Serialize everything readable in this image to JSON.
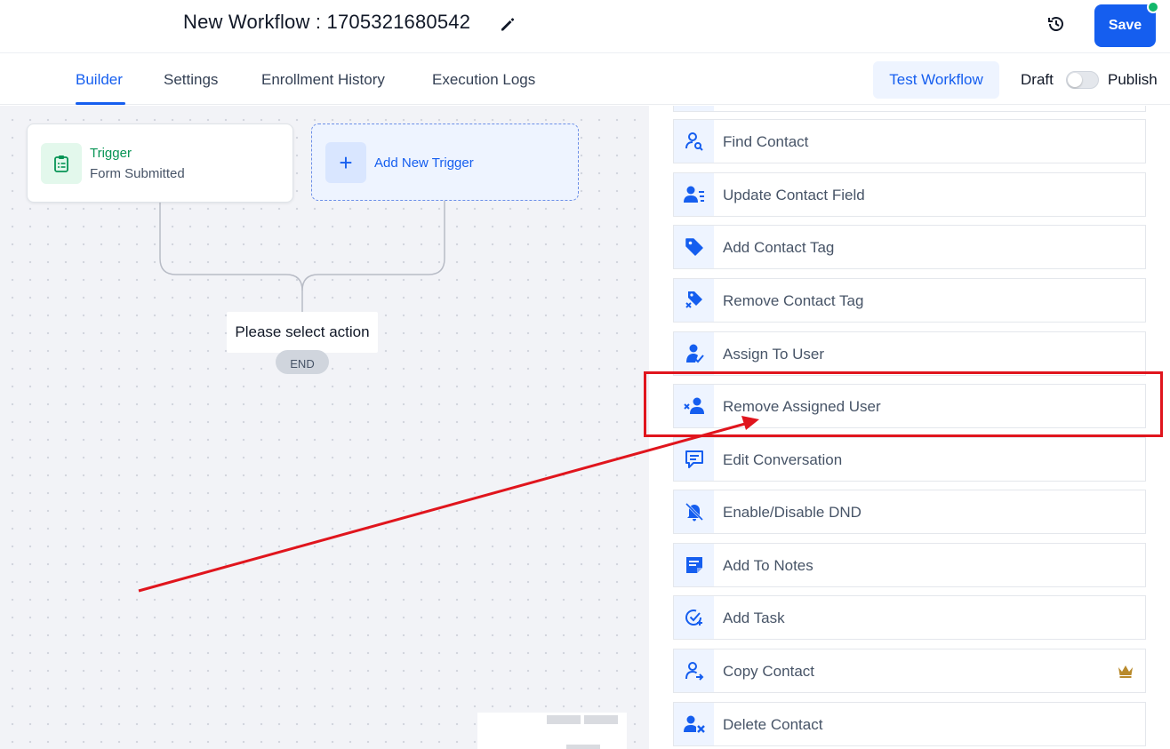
{
  "header": {
    "title": "New Workflow : 1705321680542",
    "save_label": "Save"
  },
  "tabs": [
    {
      "label": "Builder",
      "active": true
    },
    {
      "label": "Settings"
    },
    {
      "label": "Enrollment History"
    },
    {
      "label": "Execution Logs"
    }
  ],
  "toolbar": {
    "test_label": "Test Workflow",
    "draft_label": "Draft",
    "publish_label": "Publish"
  },
  "canvas": {
    "trigger": {
      "title": "Trigger",
      "subtitle": "Form Submitted"
    },
    "add_trigger_label": "Add New Trigger",
    "select_action_label": "Please select action",
    "end_label": "END"
  },
  "actions": [
    {
      "label": "Find Contact",
      "icon": "find-contact-icon"
    },
    {
      "label": "Update Contact Field",
      "icon": "update-contact-field-icon"
    },
    {
      "label": "Add Contact Tag",
      "icon": "tag-icon"
    },
    {
      "label": "Remove Contact Tag",
      "icon": "remove-tag-icon"
    },
    {
      "label": "Assign To User",
      "icon": "assign-user-icon"
    },
    {
      "label": "Remove Assigned User",
      "icon": "remove-user-icon"
    },
    {
      "label": "Edit Conversation",
      "icon": "conversation-icon"
    },
    {
      "label": "Enable/Disable DND",
      "icon": "bell-off-icon"
    },
    {
      "label": "Add To Notes",
      "icon": "notes-icon"
    },
    {
      "label": "Add Task",
      "icon": "task-icon"
    },
    {
      "label": "Copy Contact",
      "icon": "copy-contact-icon",
      "premium": true
    },
    {
      "label": "Delete Contact",
      "icon": "delete-contact-icon"
    }
  ],
  "colors": {
    "primary": "#155eef",
    "trigger_green": "#079455",
    "status_dot": "#12b76a",
    "annotation_red": "#e0151d",
    "crown": "#b98a2c"
  }
}
